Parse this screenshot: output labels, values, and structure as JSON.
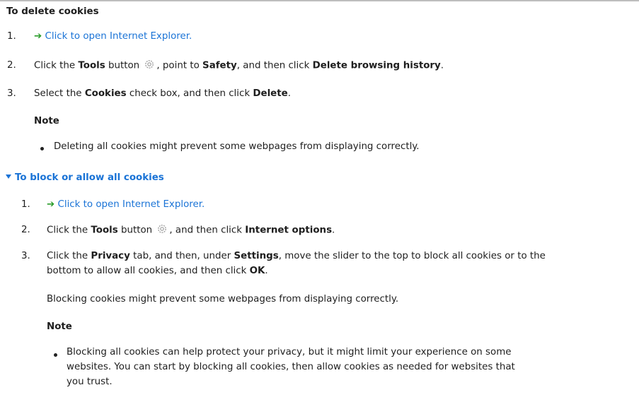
{
  "delete_section": {
    "heading": "To delete cookies",
    "step1": {
      "num": "1.",
      "link": "Click to open Internet Explorer."
    },
    "step2": {
      "num": "2.",
      "t1": "Click the ",
      "b1": "Tools",
      "t2": " button ",
      "t3": ", point to ",
      "b2": "Safety",
      "t4": ", and then click ",
      "b3": "Delete browsing history",
      "t5": "."
    },
    "step3": {
      "num": "3.",
      "t1": "Select the ",
      "b1": "Cookies",
      "t2": " check box, and then click ",
      "b2": "Delete",
      "t3": "."
    },
    "note_label": "Note",
    "note_bullet": "Deleting all cookies might prevent some webpages from displaying correctly."
  },
  "block_section": {
    "heading": "To block or allow all cookies",
    "step1": {
      "num": "1.",
      "link": "Click to open Internet Explorer."
    },
    "step2": {
      "num": "2.",
      "t1": "Click the ",
      "b1": "Tools",
      "t2": " button ",
      "t3": ", and then click ",
      "b2": "Internet options",
      "t4": "."
    },
    "step3": {
      "num": "3.",
      "t1": "Click the ",
      "b1": "Privacy",
      "t2": " tab, and then, under ",
      "b2": "Settings",
      "t3": ", move the slider to the top to block all cookies or to the",
      "t4": "bottom to allow all cookies, and then click ",
      "b3": "OK",
      "t5": "."
    },
    "warning": "Blocking cookies might prevent some webpages from displaying correctly.",
    "note_label": "Note",
    "note_bullet_line1": "Blocking all cookies can help protect your privacy, but it might limit your experience on some",
    "note_bullet_line2": "websites. You can start by blocking all cookies, then allow cookies as needed for websites that",
    "note_bullet_line3": "you trust."
  },
  "icons": {
    "link_arrow": "green-right-arrow-icon",
    "tools": "gear-icon",
    "expand": "triangle-down-icon"
  },
  "colors": {
    "link": "#1a73d6",
    "arrow": "#2a9c2a",
    "text": "#1e1e1e"
  }
}
